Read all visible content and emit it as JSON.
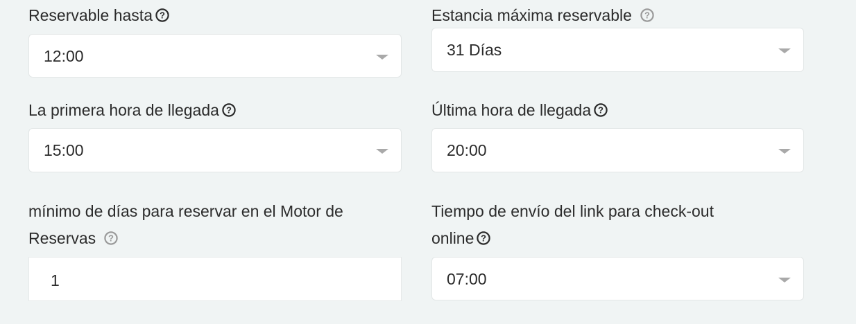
{
  "fields": {
    "reservable_until": {
      "label": "Reservable hasta",
      "value": "12:00"
    },
    "max_stay": {
      "label": "Estancia máxima reservable",
      "value": "31 Días"
    },
    "first_arrival": {
      "label": "La primera hora de llegada",
      "value": "15:00"
    },
    "last_arrival": {
      "label": "Última hora de llegada",
      "value": "20:00"
    },
    "min_days": {
      "label_line1": "mínimo de días para reservar en el Motor de",
      "label_line2": "Reservas",
      "value": "1"
    },
    "checkout_link": {
      "label_line1": "Tiempo de envío del link para check-out",
      "label_line2": "online",
      "value": "07:00"
    }
  },
  "icons": {
    "help": "question-circle-icon",
    "dropdown": "caret-down-icon"
  },
  "colors": {
    "background": "#f0f4f4",
    "help_dark": "#2b2b2b",
    "help_gray": "#9a9a9a",
    "caret": "#a9a9a9"
  }
}
